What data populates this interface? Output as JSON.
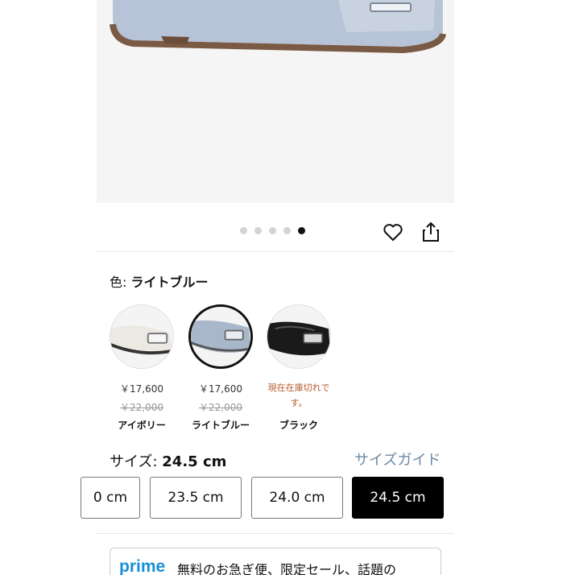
{
  "gallery": {
    "dots_total": 5,
    "active_index": 4
  },
  "actions": {
    "favorite_icon": "heart-icon",
    "share_icon": "share-icon"
  },
  "color": {
    "label": "色:",
    "selected": "ライトブルー",
    "options": [
      {
        "price": "￥17,600",
        "list_price": "￥22,000",
        "name": "アイボリー",
        "swatch_color": "#ece9e2"
      },
      {
        "price": "￥17,600",
        "list_price": "￥22,000",
        "name": "ライトブルー",
        "swatch_color": "#a9b7cb"
      },
      {
        "status_line1": "現在在庫切れで",
        "status_line2": "す。",
        "name": "ブラック",
        "swatch_color": "#1a1a1a"
      }
    ]
  },
  "size": {
    "label": "サイズ:",
    "selected": "24.5 cm",
    "guide": "サイズガイド",
    "options": [
      "0 cm",
      "23.5 cm",
      "24.0 cm",
      "24.5 cm"
    ]
  },
  "prime": {
    "logo": "prime",
    "text": "無料のお急ぎ便、限定セール、話題の"
  },
  "colors": {
    "accent_link": "#6b8aa5",
    "prime_blue": "#1a8fd8",
    "out_of_stock": "#b5572b"
  }
}
